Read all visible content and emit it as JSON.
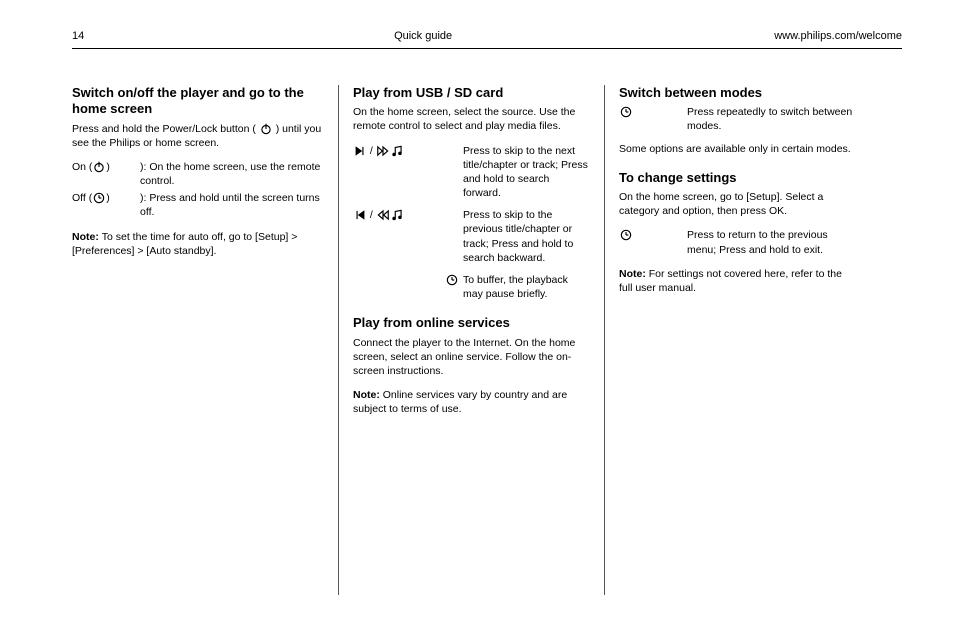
{
  "header": {
    "left": "14",
    "center": "Quick guide",
    "right": "www.philips.com/welcome"
  },
  "col1": {
    "h": "Switch on/off the player and go to the home screen",
    "body": "Press and hold the Power/Lock button (",
    "body_tail": ") until you see the Philips or home screen.",
    "bullets": [
      {
        "lead": "On (",
        "tail": "): On the home screen, use the remote control.",
        "icon": "power"
      },
      {
        "lead": "Off (",
        "tail": "): Press and hold until the screen turns off.",
        "icon": "clock"
      }
    ],
    "note": "To set the time for auto off, go to [Setup] > [Preferences] > [Auto standby].",
    "note_prefix": "Note: "
  },
  "col2": {
    "h1": "Play from USB / SD card",
    "body1": "On the home screen, select the source. Use the remote control to select and play media files.",
    "rows1": [
      {
        "icons": [
          "skip-fwd",
          "music"
        ],
        "iconsRight": [
          "ffwd"
        ],
        "text": "Press to skip to the next title/chapter or track; Press and hold to search forward."
      },
      {
        "icons": [
          "skip-back",
          "music"
        ],
        "iconsRight": [
          "rew"
        ],
        "text": "Press to skip to the previous title/chapter or track; Press and hold to search backward."
      }
    ],
    "h2": "Play from online services",
    "body2": "Connect the player to the Internet. On the home screen, select an online service. Follow the on-screen instructions.",
    "row2": {
      "icon": "clock",
      "text": "To buffer, the playback may pause briefly."
    },
    "note2": "Online services vary by country and are subject to terms of use.",
    "note_prefix": "Note: "
  },
  "col3": {
    "h1": "Switch between modes",
    "row1": {
      "icon": "clock",
      "text": "Press repeatedly to switch between modes."
    },
    "body1": "Some options are available only in certain modes.",
    "h2": "To change settings",
    "body2": "On the home screen, go to [Setup]. Select a category and option, then press OK.",
    "row2": {
      "icon": "clock",
      "text": "Press to return to the previous menu; Press and hold to exit."
    },
    "note": "For settings not covered here, refer to the full user manual.",
    "note_prefix": "Note: "
  }
}
